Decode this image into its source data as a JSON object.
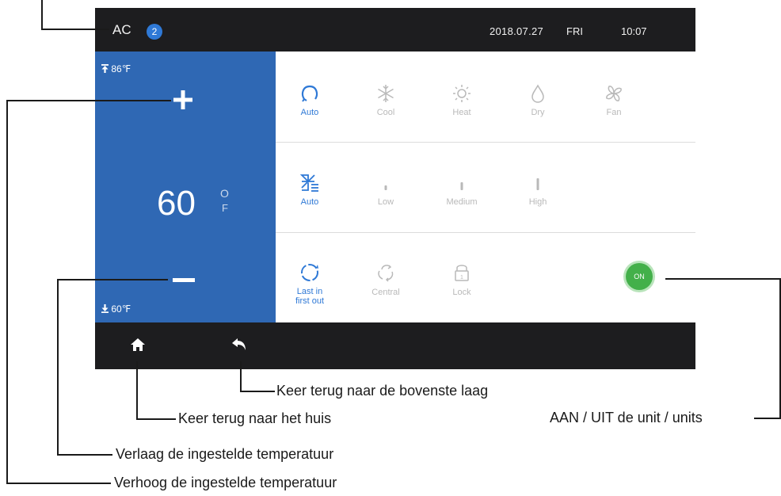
{
  "topbar": {
    "device_label": "AC",
    "device_count": "2",
    "date": "2018.07.27",
    "weekday": "FRI",
    "time": "10:07"
  },
  "temperature": {
    "max_label": "86℉",
    "min_label": "60℉",
    "value": "60",
    "unit_degree": "O",
    "unit_f": "F"
  },
  "mode": {
    "options": [
      {
        "label": "Auto",
        "icon": "mode-auto-icon",
        "active": true
      },
      {
        "label": "Cool",
        "icon": "snowflake-icon"
      },
      {
        "label": "Heat",
        "icon": "sun-icon"
      },
      {
        "label": "Dry",
        "icon": "droplet-icon"
      },
      {
        "label": "Fan",
        "icon": "fan-icon"
      }
    ]
  },
  "fan_speed": {
    "options": [
      {
        "label": "Auto",
        "icon": "fan-speed-auto-icon",
        "active": true
      },
      {
        "label": "Low",
        "icon": "speed-low-icon"
      },
      {
        "label": "Medium",
        "icon": "speed-medium-icon"
      },
      {
        "label": "High",
        "icon": "speed-high-icon"
      }
    ]
  },
  "functions": {
    "options": [
      {
        "label": "Last in first out",
        "icon": "last-in-first-out-icon",
        "active": true
      },
      {
        "label": "Central",
        "icon": "central-icon"
      },
      {
        "label": "Lock",
        "icon": "lock-icon"
      }
    ],
    "power_label": "ON"
  },
  "colors": {
    "accent": "#2f79d6",
    "panel": "#2f68b4",
    "power": "#43b04a",
    "bar": "#1d1d1f"
  },
  "callouts": {
    "top_left": "",
    "increase": "Verhoog de ingestelde temperatuur",
    "decrease": "Verlaag de ingestelde temperatuur",
    "home": "Keer terug naar het huis",
    "back": "Keer terug naar de bovenste laag",
    "power": "AAN / UIT de unit / units"
  }
}
